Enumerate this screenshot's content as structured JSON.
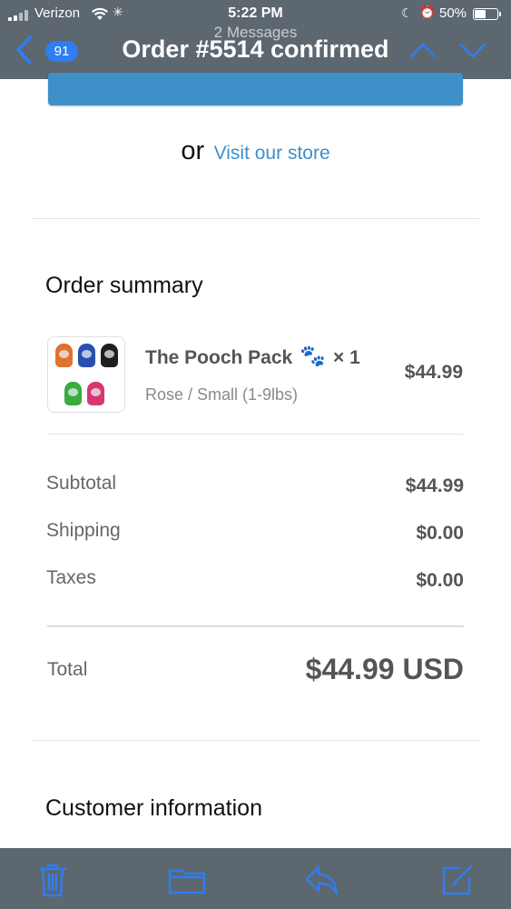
{
  "status_bar": {
    "carrier": "Verizon",
    "time": "5:22 PM",
    "battery_percent": "50%",
    "battery_level": 0.5
  },
  "nav": {
    "unread_count": "91",
    "subtitle": "2 Messages",
    "title": "Order #5514 confirmed"
  },
  "body": {
    "or_text": "or",
    "store_link": "Visit our store",
    "order_summary": {
      "heading": "Order summary",
      "item": {
        "name": "The Pooch Pack",
        "emoji": "🐾",
        "quantity": "× 1",
        "variant": "Rose / Small (1-9lbs)",
        "price": "$44.99"
      },
      "rows": [
        {
          "label": "Subtotal",
          "value": "$44.99"
        },
        {
          "label": "Shipping",
          "value": "$0.00"
        },
        {
          "label": "Taxes",
          "value": "$0.00"
        }
      ],
      "total_label": "Total",
      "total_value": "$44.99 USD"
    },
    "customer_info_heading": "Customer information"
  },
  "colors": {
    "header_bg": "#5d6770",
    "accent": "#2e7ef2",
    "link": "#3f8fc9"
  }
}
